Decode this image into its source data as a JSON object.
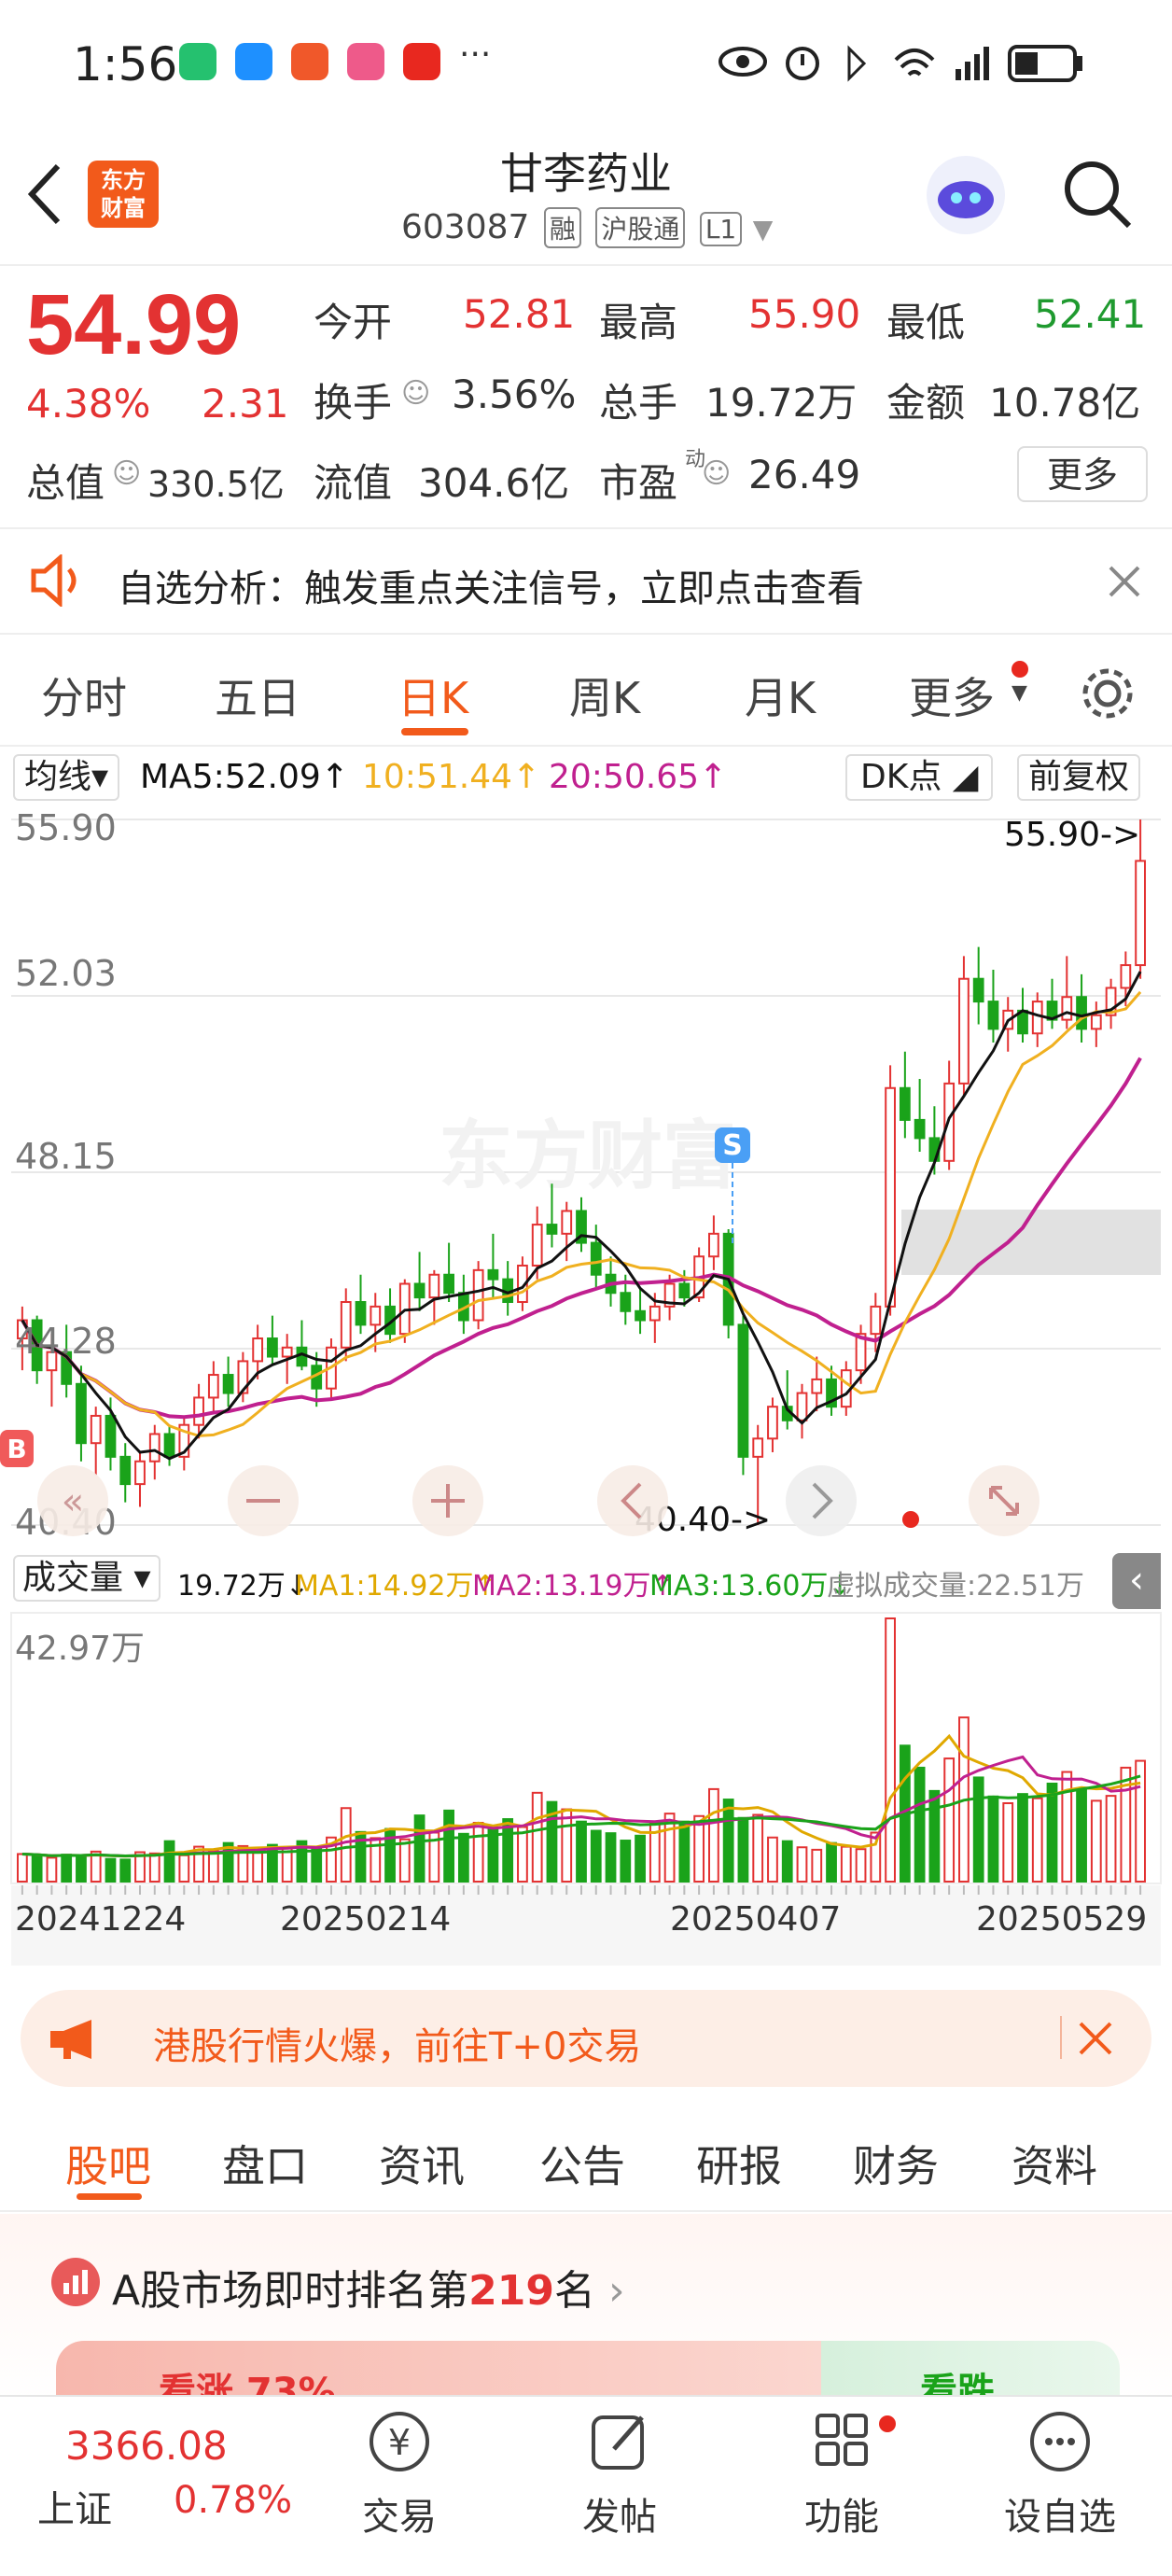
{
  "status_bar": {
    "time": "1:56",
    "more": "···"
  },
  "header": {
    "logo_text": "东方财富",
    "stock_name": "甘李药业",
    "stock_code": "603087",
    "tags": [
      "融",
      "沪股通",
      "L1"
    ]
  },
  "quote": {
    "price": "54.99",
    "change_pct": "4.38%",
    "change": "2.31",
    "open_label": "今开",
    "open": "52.81",
    "high_label": "最高",
    "high": "55.90",
    "low_label": "最低",
    "low": "52.41",
    "turnover_label": "换手",
    "turnover": "3.56%",
    "volume_label": "总手",
    "volume": "19.72万",
    "amount_label": "金额",
    "amount": "10.78亿",
    "mktcap_label": "总值",
    "mktcap": "330.5亿",
    "float_label": "流值",
    "float": "304.6亿",
    "pe_label": "市盈",
    "pe_sup": "动",
    "pe": "26.49",
    "more_label": "更多"
  },
  "alert": {
    "text": "自选分析：触发重点关注信号，立即点击查看"
  },
  "chart_tabs": [
    "分时",
    "五日",
    "日K",
    "周K",
    "月K",
    "更多"
  ],
  "active_tab": "日K",
  "ma_bar": {
    "selector": "均线",
    "ma5": "MA5:52.09↑",
    "ma10": "10:51.44↑",
    "ma20": "20:50.65↑",
    "dk": "DK点",
    "adjust": "前复权"
  },
  "chart_labels": {
    "y_ticks": [
      "55.90",
      "52.03",
      "48.15",
      "44.28",
      "40.40"
    ],
    "high_marker": "55.90->",
    "low_marker": "40.40->",
    "s_marker": "S",
    "b_marker": "B",
    "watermark": "东方财富"
  },
  "volume_bar": {
    "selector": "成交量",
    "vol": "19.72万↓",
    "ma1": "MA1:14.92万↑",
    "ma2": "MA2:13.19万↑",
    "ma3": "MA3:13.60万↓",
    "virtual": "虚拟成交量:22.51万",
    "max_label": "42.97万"
  },
  "x_dates": [
    "20241224",
    "20250214",
    "20250407",
    "20250529"
  ],
  "colors": {
    "up": "#e33232",
    "down": "#1aa31a",
    "ma5": "#111111",
    "ma10": "#f0b020",
    "ma20": "#c0208f",
    "accent": "#f25a1b"
  },
  "banner": {
    "text": "港股行情火爆，前往T+0交易"
  },
  "info_tabs": [
    "股吧",
    "盘口",
    "资讯",
    "公告",
    "研报",
    "财务",
    "资料"
  ],
  "active_info_tab": "股吧",
  "rank": {
    "prefix": "A股市场即时排名第",
    "number": "219",
    "suffix": "名",
    "bull": "看涨 73%",
    "bear": "看跌"
  },
  "footer": {
    "index_value": "3366.08",
    "index_name": "上证",
    "index_change": "0.78%",
    "items": [
      "交易",
      "发帖",
      "功能",
      "设自选"
    ]
  },
  "chart_data": {
    "type": "candlestick",
    "price_axis_range": [
      40.4,
      55.9
    ],
    "volume_axis_max": "42.97万",
    "x_axis_dates": [
      "20241224",
      "20250214",
      "20250407",
      "20250529"
    ],
    "ohlc": [
      [
        44.5,
        45.2,
        43.8,
        44.9
      ],
      [
        44.9,
        45.0,
        43.5,
        43.8
      ],
      [
        43.8,
        44.6,
        43.0,
        44.2
      ],
      [
        44.2,
        44.8,
        43.2,
        43.5
      ],
      [
        43.5,
        43.9,
        41.8,
        42.2
      ],
      [
        42.2,
        43.0,
        41.5,
        42.8
      ],
      [
        42.8,
        43.2,
        41.6,
        41.9
      ],
      [
        41.9,
        42.2,
        40.9,
        41.3
      ],
      [
        41.3,
        42.0,
        40.8,
        41.8
      ],
      [
        41.8,
        42.6,
        41.4,
        42.4
      ],
      [
        42.4,
        42.6,
        41.7,
        41.9
      ],
      [
        41.9,
        42.8,
        41.6,
        42.6
      ],
      [
        42.6,
        43.5,
        42.3,
        43.2
      ],
      [
        43.2,
        44.0,
        42.9,
        43.7
      ],
      [
        43.7,
        44.1,
        43.0,
        43.3
      ],
      [
        43.3,
        44.2,
        43.1,
        44.0
      ],
      [
        44.0,
        44.8,
        43.6,
        44.5
      ],
      [
        44.5,
        45.0,
        43.9,
        44.1
      ],
      [
        44.1,
        44.6,
        43.5,
        44.3
      ],
      [
        44.3,
        44.9,
        43.8,
        43.9
      ],
      [
        43.9,
        44.2,
        43.0,
        43.4
      ],
      [
        43.4,
        44.5,
        43.2,
        44.3
      ],
      [
        44.3,
        45.6,
        44.0,
        45.3
      ],
      [
        45.3,
        45.9,
        44.6,
        44.8
      ],
      [
        44.8,
        45.5,
        44.2,
        45.2
      ],
      [
        45.2,
        45.6,
        44.4,
        44.6
      ],
      [
        44.6,
        45.8,
        44.4,
        45.7
      ],
      [
        45.7,
        46.4,
        45.1,
        45.4
      ],
      [
        45.4,
        46.0,
        44.8,
        45.9
      ],
      [
        45.9,
        46.6,
        45.3,
        45.5
      ],
      [
        45.5,
        45.9,
        44.6,
        44.9
      ],
      [
        44.9,
        46.2,
        44.7,
        46.0
      ],
      [
        46.0,
        46.8,
        45.4,
        45.8
      ],
      [
        45.8,
        46.2,
        45.0,
        45.3
      ],
      [
        45.3,
        46.3,
        45.1,
        46.1
      ],
      [
        46.1,
        47.4,
        45.8,
        47.0
      ],
      [
        47.0,
        47.9,
        46.5,
        46.8
      ],
      [
        46.8,
        47.5,
        46.2,
        47.3
      ],
      [
        47.3,
        47.6,
        46.4,
        46.6
      ],
      [
        46.6,
        47.0,
        45.6,
        45.9
      ],
      [
        45.9,
        46.3,
        45.2,
        45.5
      ],
      [
        45.5,
        45.9,
        44.8,
        45.1
      ],
      [
        45.1,
        45.6,
        44.6,
        44.9
      ],
      [
        44.9,
        45.5,
        44.4,
        45.2
      ],
      [
        45.2,
        45.9,
        44.9,
        45.7
      ],
      [
        45.7,
        46.0,
        45.2,
        45.4
      ],
      [
        45.4,
        46.5,
        45.3,
        46.3
      ],
      [
        46.3,
        47.2,
        46.0,
        46.8
      ],
      [
        46.8,
        46.9,
        44.5,
        44.8
      ],
      [
        44.8,
        45.0,
        41.5,
        41.9
      ],
      [
        41.9,
        42.6,
        40.4,
        42.3
      ],
      [
        42.3,
        43.2,
        42.0,
        43.0
      ],
      [
        43.0,
        43.8,
        42.5,
        42.7
      ],
      [
        42.7,
        43.5,
        42.3,
        43.3
      ],
      [
        43.3,
        44.1,
        42.9,
        43.6
      ],
      [
        43.6,
        43.9,
        42.8,
        43.0
      ],
      [
        43.0,
        44.0,
        42.8,
        43.8
      ],
      [
        43.8,
        44.8,
        43.5,
        44.6
      ],
      [
        44.6,
        45.5,
        44.2,
        45.2
      ],
      [
        45.2,
        50.5,
        45.0,
        50.0
      ],
      [
        50.0,
        50.8,
        48.9,
        49.3
      ],
      [
        49.3,
        50.2,
        48.6,
        48.9
      ],
      [
        48.9,
        49.6,
        48.1,
        48.4
      ],
      [
        48.4,
        50.6,
        48.2,
        50.1
      ],
      [
        50.1,
        52.9,
        49.8,
        52.4
      ],
      [
        52.4,
        53.1,
        51.4,
        51.9
      ],
      [
        51.9,
        52.6,
        51.0,
        51.3
      ],
      [
        51.3,
        52.0,
        50.8,
        51.7
      ],
      [
        51.7,
        52.2,
        51.0,
        51.2
      ],
      [
        51.2,
        52.1,
        50.9,
        51.9
      ],
      [
        51.9,
        52.4,
        51.3,
        51.5
      ],
      [
        51.5,
        52.9,
        51.3,
        52.0
      ],
      [
        52.0,
        52.5,
        51.0,
        51.3
      ],
      [
        51.3,
        51.9,
        50.9,
        51.6
      ],
      [
        51.6,
        52.4,
        51.3,
        52.2
      ],
      [
        52.2,
        53.0,
        51.8,
        52.7
      ],
      [
        52.7,
        55.9,
        52.4,
        54.99
      ]
    ],
    "volume_wan": [
      4.5,
      4.3,
      3.9,
      4.4,
      4.2,
      4.9,
      3.7,
      3.6,
      4.8,
      4.6,
      6.6,
      4.3,
      5.7,
      5.0,
      6.3,
      5.8,
      4.7,
      6.0,
      5.4,
      6.6,
      5.6,
      7.2,
      12.0,
      8.1,
      7.1,
      8.6,
      6.9,
      10.8,
      8.0,
      11.6,
      7.8,
      9.6,
      8.5,
      10.2,
      8.9,
      14.5,
      13.0,
      11.8,
      9.8,
      8.3,
      7.9,
      6.7,
      7.5,
      9.6,
      11.1,
      9.8,
      10.7,
      15.1,
      13.4,
      10.4,
      10.9,
      7.2,
      6.6,
      5.6,
      5.2,
      6.3,
      5.7,
      5.3,
      8.0,
      42.97,
      22.2,
      18.6,
      14.8,
      20.1,
      26.8,
      17.0,
      13.9,
      12.8,
      14.3,
      13.6,
      16.0,
      17.9,
      15.0,
      13.2,
      14.0,
      18.6,
      19.72
    ]
  }
}
